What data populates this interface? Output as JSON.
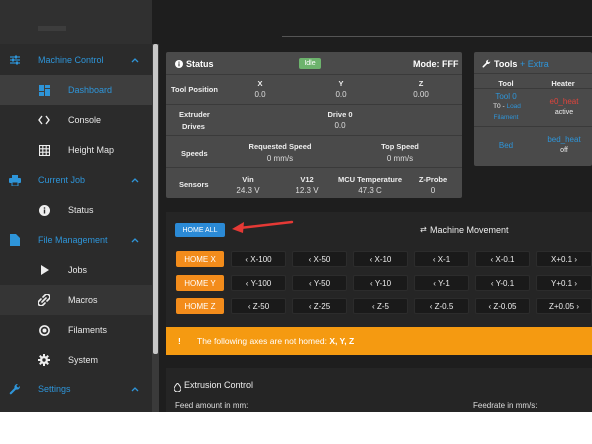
{
  "sidebar": {
    "machine_control": "Machine Control",
    "dashboard": "Dashboard",
    "console": "Console",
    "height_map": "Height Map",
    "current_job": "Current Job",
    "status": "Status",
    "file_management": "File Management",
    "jobs": "Jobs",
    "macros": "Macros",
    "filaments": "Filaments",
    "system": "System",
    "settings": "Settings"
  },
  "status": {
    "title": "Status",
    "state": "Idle",
    "mode": "Mode: FFF",
    "tool_position_label": "Tool Position",
    "axes": [
      "X",
      "Y",
      "Z"
    ],
    "positions": [
      "0.0",
      "0.0",
      "0.00"
    ],
    "extruder_label_1": "Extruder",
    "extruder_label_2": "Drives",
    "drive_name": "Drive 0",
    "drive_value": "0.0",
    "speeds_label": "Speeds",
    "requested_speed_label": "Requested Speed",
    "requested_speed_value": "0 mm/s",
    "top_speed_label": "Top Speed",
    "top_speed_value": "0 mm/s",
    "sensors_label": "Sensors",
    "sensor_names": [
      "Vin",
      "V12",
      "MCU Temperature",
      "Z-Probe"
    ],
    "sensor_values": [
      "24.3 V",
      "12.3 V",
      "47.3 C",
      "0"
    ]
  },
  "tools": {
    "title": "Tools",
    "extra": "+ Extra",
    "col_tool": "Tool",
    "col_heater": "Heater",
    "tool0_name": "Tool 0",
    "tool0_prefix": "T0 - ",
    "tool0_load": "Load",
    "tool0_filament": "Filament",
    "tool0_heater": "e0_heat",
    "tool0_heater_state": "active",
    "bed_name": "Bed",
    "bed_heater": "bed_heat",
    "bed_heater_state": "off"
  },
  "movement": {
    "home_all": "HOME ALL",
    "title": "Machine Movement",
    "home_x": "HOME X",
    "home_y": "HOME Y",
    "home_z": "HOME Z",
    "x_jogs": [
      "X-100",
      "X-50",
      "X-10",
      "X-1",
      "X-0.1",
      "X+0.1"
    ],
    "y_jogs": [
      "Y-100",
      "Y-50",
      "Y-10",
      "Y-1",
      "Y-0.1",
      "Y+0.1"
    ],
    "z_jogs": [
      "Z-50",
      "Z-25",
      "Z-5",
      "Z-0.5",
      "Z-0.05",
      "Z+0.05"
    ]
  },
  "warning": {
    "icon": "!",
    "text": "The following axes are not homed: ",
    "axes": "X, Y, Z"
  },
  "extrusion": {
    "title": "Extrusion Control",
    "feed_amount": "Feed amount in mm:",
    "feedrate": "Feedrate in mm/s:"
  },
  "colors": {
    "accent": "#2e95d9",
    "orange": "#f38c1b",
    "warning": "#f59a11",
    "idle": "#6db36d",
    "heater_active": "#e0443c"
  }
}
